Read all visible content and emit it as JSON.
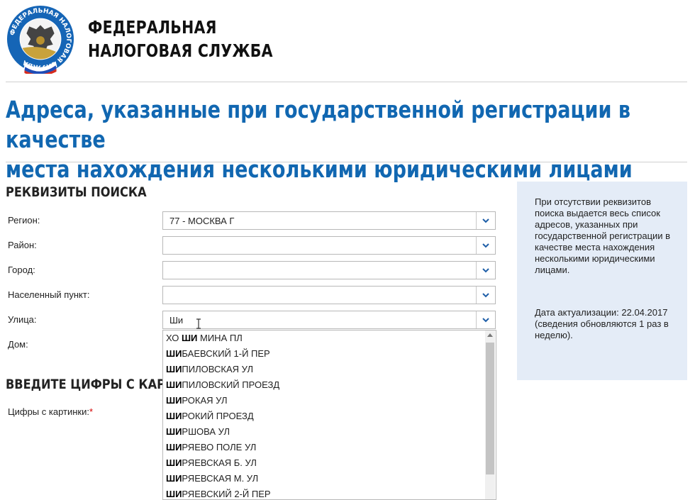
{
  "header": {
    "org_name_line1": "ФЕДЕРАЛЬНАЯ",
    "org_name_line2": "НАЛОГОВАЯ СЛУЖБА",
    "logo_ring_text": "ФЕДЕРАЛЬНАЯ НАЛОГОВАЯ СЛУЖБА",
    "logo_icon": "fns-emblem-icon"
  },
  "page": {
    "title_line1": "Адреса, указанные при государственной регистрации в качестве",
    "title_line2": "места нахождения несколькими юридическими лицами"
  },
  "search": {
    "section_title": "РЕКВИЗИТЫ ПОИСКА",
    "fields": [
      {
        "label": "Регион:",
        "value": "77 - МОСКВА Г"
      },
      {
        "label": "Район:",
        "value": ""
      },
      {
        "label": "Город:",
        "value": ""
      },
      {
        "label": "Населенный пункт:",
        "value": ""
      },
      {
        "label": "Улица:",
        "value": "Ши"
      },
      {
        "label": "Дом:",
        "value": ""
      }
    ]
  },
  "captcha": {
    "section_title": "ВВЕДИТЕ ЦИФРЫ С КАРТИНКИ",
    "label": "Цифры с картинки:",
    "required_mark": "*"
  },
  "street_suggestions": [
    {
      "pre": "ХО ",
      "match": "ШИ",
      "post": " МИНА ПЛ"
    },
    {
      "pre": "",
      "match": "ШИ",
      "post": "БАЕВСКИЙ 1-Й ПЕР"
    },
    {
      "pre": "",
      "match": "ШИ",
      "post": "ПИЛОВСКАЯ УЛ"
    },
    {
      "pre": "",
      "match": "ШИ",
      "post": "ПИЛОВСКИЙ ПРОЕЗД"
    },
    {
      "pre": "",
      "match": "ШИ",
      "post": "РОКАЯ УЛ"
    },
    {
      "pre": "",
      "match": "ШИ",
      "post": "РОКИЙ ПРОЕЗД"
    },
    {
      "pre": "",
      "match": "ШИ",
      "post": "РШОВА УЛ"
    },
    {
      "pre": "",
      "match": "ШИ",
      "post": "РЯЕВО ПОЛЕ УЛ"
    },
    {
      "pre": "",
      "match": "ШИ",
      "post": "РЯЕВСКАЯ Б. УЛ"
    },
    {
      "pre": "",
      "match": "ШИ",
      "post": "РЯЕВСКАЯ М. УЛ"
    },
    {
      "pre": "",
      "match": "ШИ",
      "post": "РЯЕВСКИЙ 2-Й ПЕР"
    }
  ],
  "info": {
    "text1": "При отсутствии реквизитов поиска выдается весь список адресов, указанных при государственной регистрации в качестве места нахождения несколькими юридическими лицами.",
    "text2": "Дата актуализации: 22.04.2017 (сведения обновляются 1 раз в неделю)."
  },
  "colors": {
    "title_blue": "#1167b1",
    "info_bg": "#e4ecf7",
    "required_red": "#d40000"
  }
}
